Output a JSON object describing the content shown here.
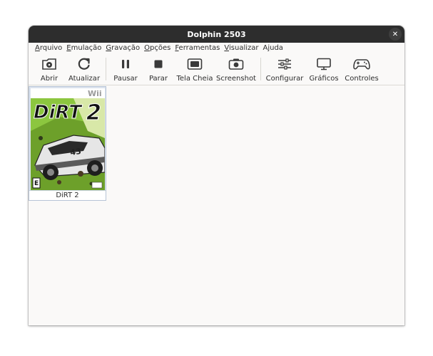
{
  "window": {
    "title": "Dolphin 2503",
    "close_glyph": "✕"
  },
  "menu": [
    {
      "label": "Arquivo",
      "accel": "A",
      "rest": "rquivo"
    },
    {
      "label": "Emulação",
      "accel": "E",
      "rest": "mulação"
    },
    {
      "label": "Gravação",
      "accel": "G",
      "rest": "ravação"
    },
    {
      "label": "Opções",
      "accel": "O",
      "rest": "pções"
    },
    {
      "label": "Ferramentas",
      "accel": "F",
      "rest": "erramentas"
    },
    {
      "label": "Visualizar",
      "accel": "V",
      "rest": "isualizar"
    },
    {
      "label": "Ajuda",
      "pre": "A",
      "accel": "j",
      "rest": "uda"
    }
  ],
  "toolbar": {
    "open": "Abrir",
    "refresh": "Atualizar",
    "pause": "Pausar",
    "stop": "Parar",
    "fullscreen": "Tela Cheia",
    "screenshot": "Screenshot",
    "configure": "Configurar",
    "graphics": "Gráficos",
    "controllers": "Controles"
  },
  "icons": {
    "open": "disc-folder-icon",
    "refresh": "refresh-icon",
    "pause": "pause-icon",
    "stop": "stop-icon",
    "fullscreen": "fullscreen-icon",
    "screenshot": "camera-icon",
    "configure": "sliders-icon",
    "graphics": "monitor-icon",
    "controllers": "gamepad-icon"
  },
  "games": [
    {
      "title": "DiRT 2",
      "cover": {
        "platform_logo": "Wii",
        "logo_text": "DiRT",
        "logo_number": "2",
        "car_number": "43",
        "rating": "E"
      }
    }
  ],
  "colors": {
    "titlebar": "#2d2d2d",
    "selection": "#dbe3ee",
    "cover_green": "#8cc63f"
  }
}
